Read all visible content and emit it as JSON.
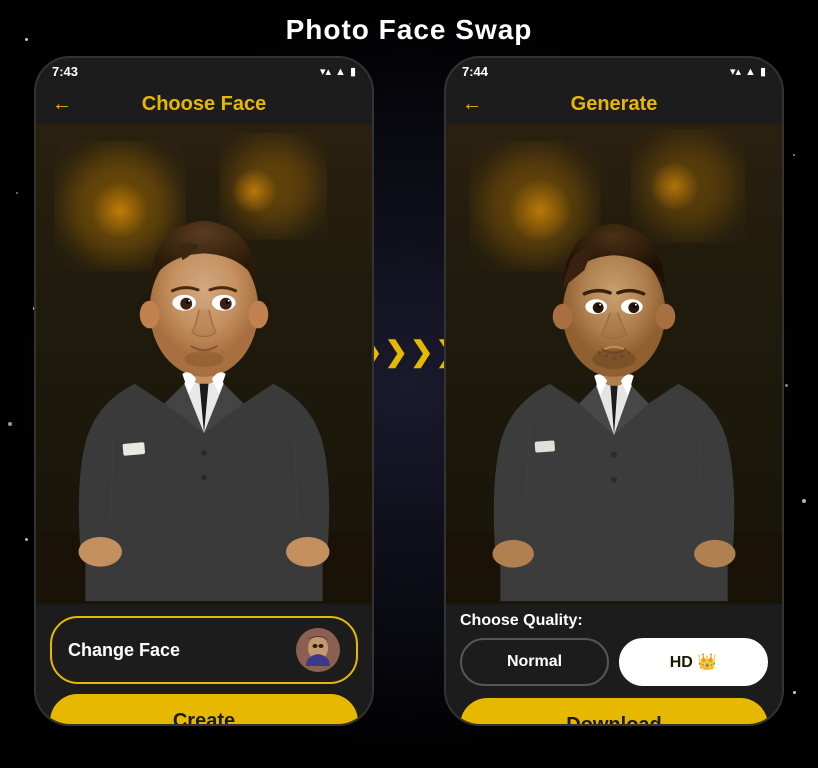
{
  "page": {
    "title": "Photo Face Swap",
    "background_color": "#000"
  },
  "left_phone": {
    "status_bar": {
      "time": "7:43",
      "icons": [
        "▼",
        "◀",
        "⚡"
      ]
    },
    "header": {
      "back_arrow": "←",
      "title": "Choose Face"
    },
    "bottom": {
      "change_face_label": "Change Face",
      "create_label": "Create"
    }
  },
  "right_phone": {
    "status_bar": {
      "time": "7:44",
      "icons": [
        "▼",
        "◀",
        "⚡"
      ]
    },
    "header": {
      "back_arrow": "←",
      "title": "Generate"
    },
    "quality": {
      "label": "Choose Quality:",
      "normal_label": "Normal",
      "hd_label": "HD 👑"
    },
    "download_label": "Download"
  },
  "arrow": {
    "symbols": [
      "❯",
      "❯",
      "❯",
      "❯"
    ]
  }
}
